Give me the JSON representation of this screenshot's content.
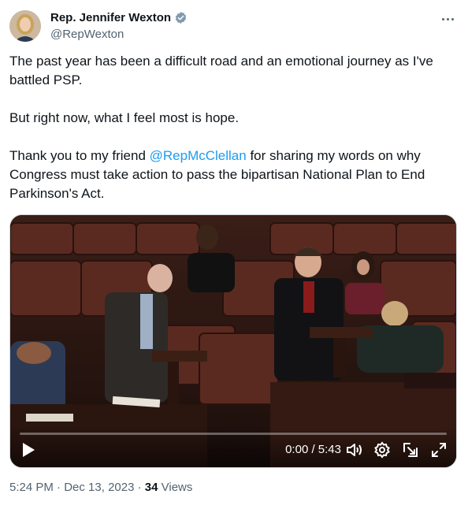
{
  "author": {
    "name": "Rep. Jennifer Wexton",
    "handle": "@RepWexton"
  },
  "tweet": {
    "para1": "The past year has been a difficult road and an emotional journey as I've battled PSP.",
    "para2": "But right now, what I feel most is hope.",
    "para3_prefix": "Thank you to my friend ",
    "mention": "@RepMcClellan",
    "para3_suffix": " for sharing my words on why Congress must take action to pass the bipartisan National Plan to End Parkinson's Act."
  },
  "video": {
    "time": "0:00 / 5:43",
    "progress": 0
  },
  "footer": {
    "time": "5:24 PM",
    "sep1": " · ",
    "date": "Dec 13, 2023",
    "sep2": " · ",
    "views_count": "34",
    "views_label": " Views"
  },
  "icons": [
    "verified-badge-icon",
    "more-options-icon",
    "play-icon",
    "volume-icon",
    "settings-icon",
    "pip-icon",
    "fullscreen-icon"
  ],
  "colors": {
    "accent": "#1d9bf0",
    "secondary_text": "#536471",
    "text": "#0f1419"
  }
}
